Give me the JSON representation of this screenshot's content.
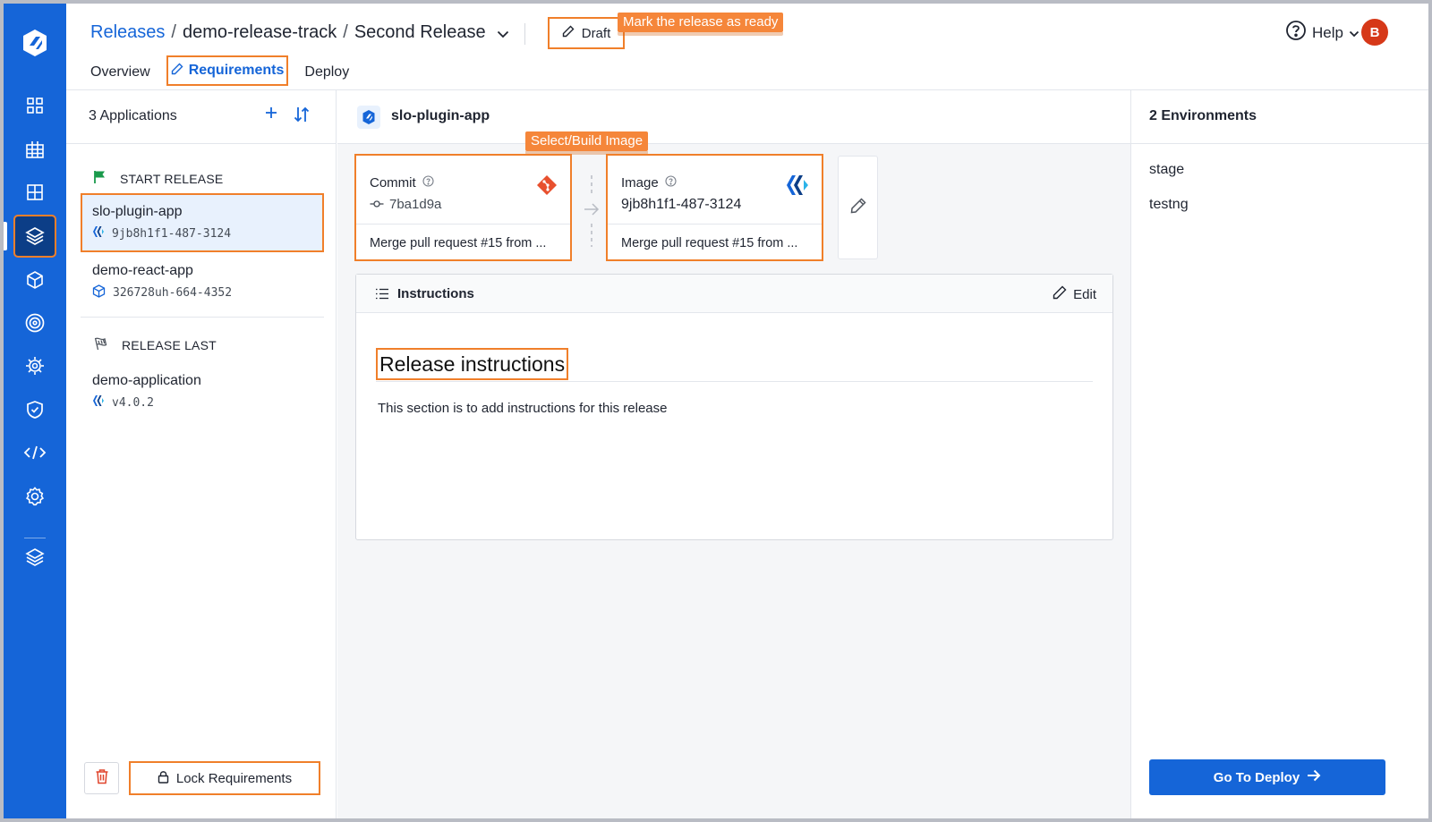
{
  "header": {
    "breadcrumb": {
      "root": "Releases",
      "track": "demo-release-track",
      "current": "Second Release",
      "separator": "/"
    },
    "draft_label": "Draft",
    "help_label": "Help",
    "avatar_initial": "B",
    "tabs": [
      {
        "label": "Overview",
        "active": false
      },
      {
        "label": "Requirements",
        "active": true
      },
      {
        "label": "Deploy",
        "active": false
      }
    ]
  },
  "annotations": {
    "mark_ready": "Mark the release as ready",
    "select_build": "Select/Build Image"
  },
  "sidebar_icons": [
    "logo-icon",
    "dashboard-icon",
    "grid-icon",
    "layout-icon",
    "releases-icon",
    "package-icon",
    "target-icon",
    "bug-icon",
    "shield-icon",
    "code-icon",
    "settings-icon",
    "layers-icon"
  ],
  "applications": {
    "count_label": "3 Applications",
    "start_section": "START RELEASE",
    "last_section": "RELEASE LAST",
    "items": [
      {
        "name": "slo-plugin-app",
        "version": "9jb8h1f1-487-3124",
        "icon": "image-registry-icon",
        "selected": true
      },
      {
        "name": "demo-react-app",
        "version": "326728uh-664-4352",
        "icon": "package-icon",
        "selected": false
      },
      {
        "name": "demo-application",
        "version": "v4.0.2",
        "icon": "image-registry-icon",
        "selected": false
      }
    ],
    "lock_label": "Lock Requirements"
  },
  "detail": {
    "app_name": "slo-plugin-app",
    "commit": {
      "label": "Commit",
      "value": "7ba1d9a",
      "message": "Merge pull request #15 from ..."
    },
    "image": {
      "label": "Image",
      "value": "9jb8h1f1-487-3124",
      "message": "Merge pull request #15 from ..."
    },
    "instructions": {
      "title": "Instructions",
      "edit_label": "Edit",
      "heading": "Release instructions",
      "body": "This section is to add instructions for this release"
    }
  },
  "environments": {
    "count_label": "2 Environments",
    "items": [
      "stage",
      "testng"
    ],
    "deploy_label": "Go To Deploy"
  },
  "colors": {
    "brand": "#1565d8",
    "highlight": "#f07f2a",
    "git": "#e8502e"
  }
}
